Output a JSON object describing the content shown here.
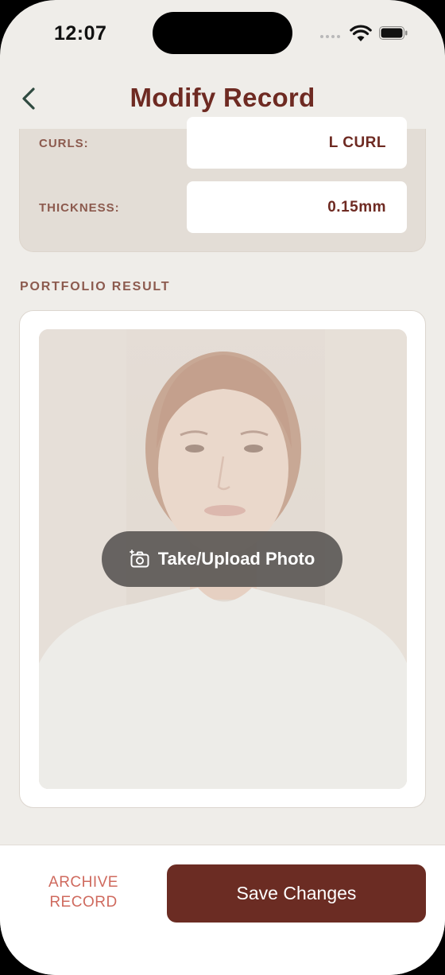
{
  "status_bar": {
    "time": "12:07"
  },
  "header": {
    "title": "Modify Record"
  },
  "specs": [
    {
      "label": "CURLS:",
      "value": "L CURL"
    },
    {
      "label": "THICKNESS:",
      "value": "0.15mm"
    }
  ],
  "portfolio": {
    "section_label": "PORTFOLIO RESULT",
    "upload_label": "Take/Upload Photo"
  },
  "footer": {
    "archive_line1": "ARCHIVE",
    "archive_line2": "RECORD",
    "save_label": "Save Changes"
  },
  "colors": {
    "accent": "#6e2a22",
    "save_button": "#6b2c23",
    "archive_text": "#cf6a5e",
    "background": "#efede9"
  },
  "icons": [
    "back-chevron-icon",
    "wifi-icon",
    "battery-icon",
    "camera-plus-icon"
  ]
}
